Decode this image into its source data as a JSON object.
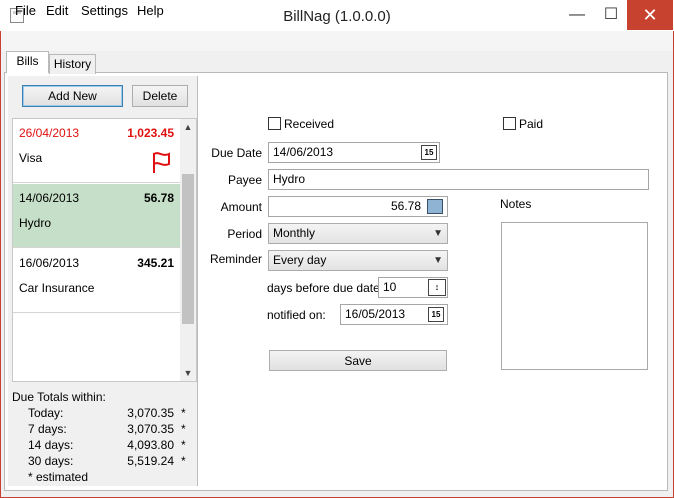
{
  "window": {
    "title": "BillNag (1.0.0.0)",
    "minimize_glyph": "—",
    "maximize_glyph": "☐",
    "close_glyph": "✕"
  },
  "menu": {
    "file": "File",
    "edit": "Edit",
    "settings": "Settings",
    "help": "Help"
  },
  "tabs": {
    "bills": "Bills",
    "history": "History"
  },
  "left": {
    "add_new": "Add New",
    "delete": "Delete",
    "bills": [
      {
        "date": "26/04/2013",
        "amount": "1,023.45",
        "name": "Visa",
        "overdue": true,
        "flag": true
      },
      {
        "date": "14/06/2013",
        "amount": "56.78",
        "name": "Hydro",
        "selected": true
      },
      {
        "date": "16/06/2013",
        "amount": "345.21",
        "name": "Car Insurance"
      }
    ],
    "totals": {
      "title": "Due Totals within:",
      "rows": [
        {
          "label": "Today:",
          "value": "3,070.35",
          "star": "*"
        },
        {
          "label": "7 days:",
          "value": "3,070.35",
          "star": "*"
        },
        {
          "label": "14 days:",
          "value": "4,093.80",
          "star": "*"
        },
        {
          "label": "30 days:",
          "value": "5,519.24",
          "star": "*"
        }
      ],
      "estimated": "* estimated"
    }
  },
  "form": {
    "received_label": "Received",
    "paid_label": "Paid",
    "due_date_label": "Due Date",
    "due_date_value": "14/06/2013",
    "payee_label": "Payee",
    "payee_value": "Hydro",
    "amount_label": "Amount",
    "amount_value": "56.78",
    "period_label": "Period",
    "period_value": "Monthly",
    "reminder_label": "Reminder",
    "reminder_value": "Every day",
    "days_before_label": "days before due date:",
    "days_before_value": "10",
    "notified_label": "notified on:",
    "notified_value": "16/05/2013",
    "save_label": "Save",
    "notes_label": "Notes",
    "calendar_glyph": "15"
  },
  "colors": {
    "overdue": "#e01010",
    "selected_row": "#c6dfc8",
    "close_button": "#c7432f"
  }
}
